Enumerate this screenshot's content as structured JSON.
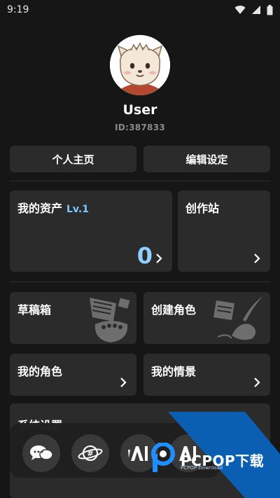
{
  "status_bar": {
    "time": "9:19"
  },
  "profile": {
    "username": "User",
    "user_id": "ID:387833"
  },
  "actions": {
    "personal_home": "个人主页",
    "edit_settings": "编辑设定"
  },
  "cards": {
    "assets": {
      "title": "我的资产",
      "level": "Lv.1",
      "value": "0"
    },
    "creation_station": {
      "title": "创作站"
    },
    "drafts": {
      "title": "草稿箱"
    },
    "create_character": {
      "title": "创建角色"
    },
    "my_characters": {
      "title": "我的角色"
    },
    "my_scenes": {
      "title": "我的情景"
    },
    "system_settings": {
      "title": "系统设置"
    }
  },
  "dock": {
    "items": [
      {
        "icon": "chat-bubbles-icon"
      },
      {
        "icon": "hashtag-planet-icon"
      },
      {
        "icon": "ai-logo-icon"
      },
      {
        "icon": "ai-logo-alt-icon"
      }
    ]
  },
  "watermark": {
    "text": "PCPOP下载",
    "sub": "PCPOP Download"
  },
  "colors": {
    "background": "#161616",
    "card": "#2b2b2b",
    "accent_blue": "#8fd0ff",
    "level_blue": "#7cc6ff",
    "watermark_blue": "#0b5fb3"
  }
}
